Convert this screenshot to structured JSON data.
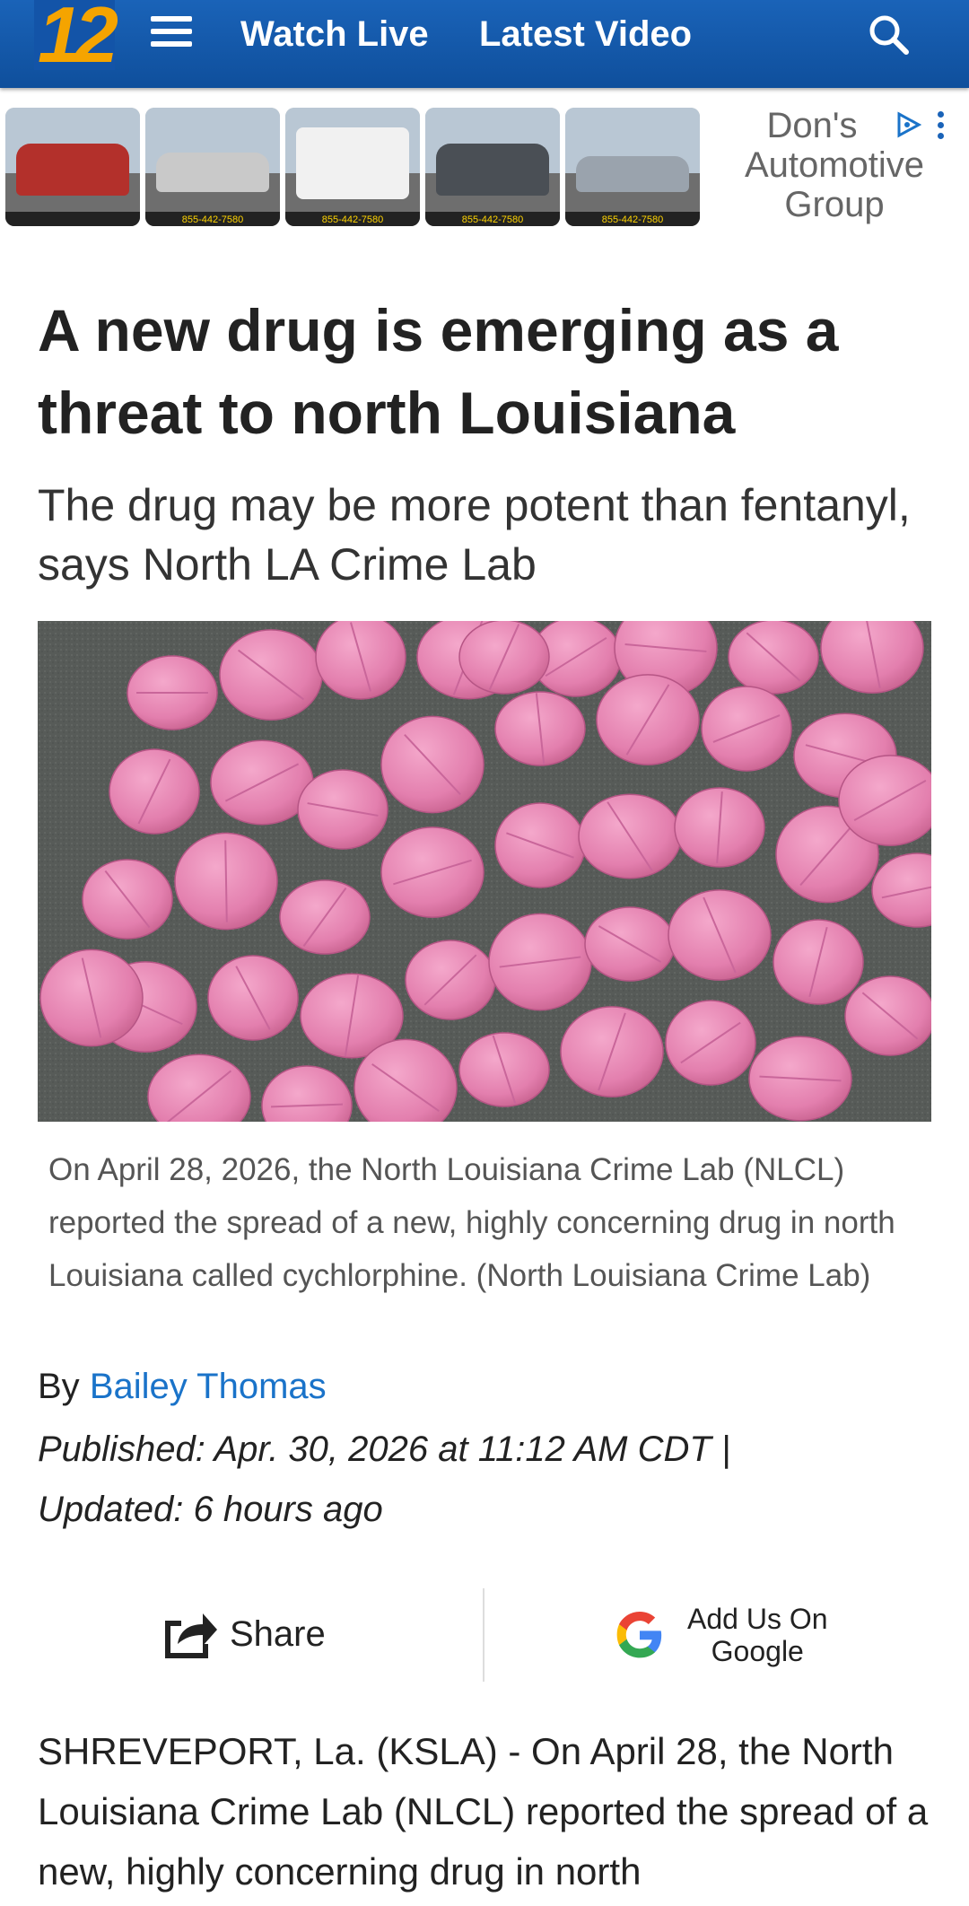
{
  "header": {
    "logo_text": "12",
    "nav": [
      "Watch Live",
      "Latest Video"
    ]
  },
  "ad": {
    "brand": "Don's Automotive Group",
    "brand_lines": [
      "Don's",
      "Automotive",
      "Group"
    ],
    "thumbs": [
      {
        "vehicle_color": "#b3302b",
        "phone": ""
      },
      {
        "vehicle_color": "#c9c9c9",
        "phone": "855-442-7580"
      },
      {
        "vehicle_color": "#f1f1f1",
        "phone": "855-442-7580"
      },
      {
        "vehicle_color": "#4a4f55",
        "phone": "855-442-7580"
      },
      {
        "vehicle_color": "#9aa3ad",
        "phone": "855-442-7580"
      }
    ]
  },
  "article": {
    "headline": "A new drug is emerging as a threat to north Louisiana",
    "subhead": "The drug may be more potent than fentanyl, says North LA Crime Lab",
    "caption": "On April 28, 2026, the North Louisiana Crime Lab (NLCL) reported the spread of a new, highly concerning drug in north Louisiana called cychlorphine.  (North Louisiana Crime Lab)",
    "byline_prefix": "By",
    "author": "Bailey Thomas",
    "published": "Published: Apr. 30, 2026 at 11:12 AM CDT  |",
    "updated": "Updated: 6 hours ago",
    "body": "SHREVEPORT, La. (KSLA) - On April 28, the North Louisiana Crime Lab (NLCL) reported the spread of a new, highly concerning drug in north"
  },
  "actions": {
    "share_label": "Share",
    "google_line1": "Add Us On",
    "google_line2": "Google"
  },
  "colors": {
    "header": "#1560b5",
    "logo": "#f5a400",
    "link": "#1a73c9",
    "pill": "#e987b4"
  },
  "icons": [
    "hamburger-icon",
    "search-icon",
    "ad-choices-icon",
    "share-icon",
    "google-icon"
  ]
}
